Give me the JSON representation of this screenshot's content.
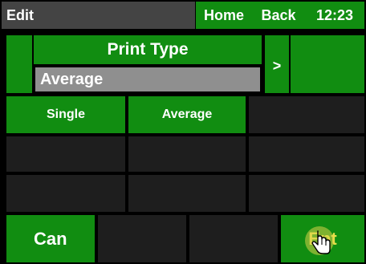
{
  "header": {
    "title": "Edit",
    "home_label": "Home",
    "back_label": "Back",
    "time": "12:23"
  },
  "parameter": {
    "title": "Print Type",
    "value": "Average",
    "next_label": ">"
  },
  "options": {
    "single_label": "Single",
    "average_label": "Average"
  },
  "footer": {
    "cancel_label": "Can",
    "enter_label": "Ent"
  },
  "colors": {
    "accent_green": "#118d11",
    "value_field_gray": "#8f8f8f",
    "empty_cell": "#1e1e1e",
    "header_gray": "#444444",
    "enter_text": "#e8e04a"
  },
  "icons": {
    "cursor": "hand-pointer-icon"
  }
}
